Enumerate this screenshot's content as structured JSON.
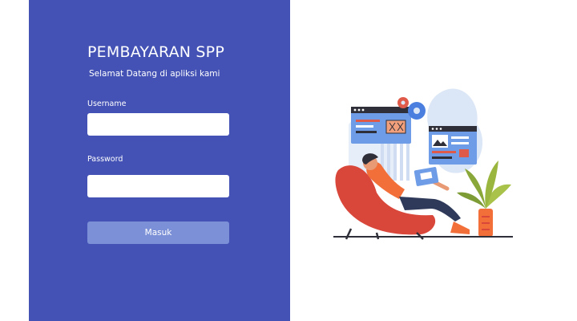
{
  "login": {
    "title": "PEMBAYARAN SPP",
    "subtitle": "Selamat Datang di apliksi kami",
    "username_label": "Username",
    "username_value": "",
    "password_label": "Password",
    "password_value": "",
    "submit_label": "Masuk"
  },
  "illustration": {
    "icon": "person-with-laptop-illustration"
  },
  "colors": {
    "panel_bg": "#4352b4",
    "button_bg": "#7b90d6",
    "accent_orange": "#f26f3a",
    "chair_red": "#d9463a"
  }
}
